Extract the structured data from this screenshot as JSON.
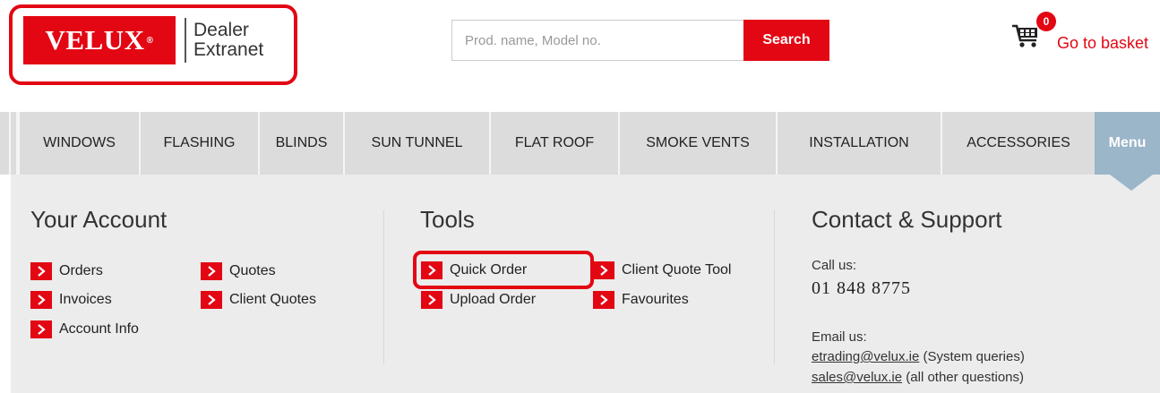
{
  "header": {
    "logo": {
      "brand": "VELUX",
      "registered": "®",
      "line1": "Dealer",
      "line2": "Extranet"
    },
    "search": {
      "placeholder": "Prod. name, Model no.",
      "value": "",
      "button_label": "Search"
    },
    "basket": {
      "count": "0",
      "label": "Go to basket",
      "icon": "shopping-cart-icon"
    }
  },
  "nav": {
    "items": [
      {
        "label": "WINDOWS"
      },
      {
        "label": "FLASHING"
      },
      {
        "label": "BLINDS"
      },
      {
        "label": "SUN TUNNEL"
      },
      {
        "label": "FLAT ROOF"
      },
      {
        "label": "SMOKE VENTS"
      },
      {
        "label": "INSTALLATION"
      },
      {
        "label": "ACCESSORIES"
      }
    ],
    "menu_label": "Menu"
  },
  "your_account": {
    "title": "Your Account",
    "links": [
      {
        "label": "Orders"
      },
      {
        "label": "Invoices"
      },
      {
        "label": "Account Info"
      },
      {
        "label": "Quotes"
      },
      {
        "label": "Client Quotes"
      }
    ]
  },
  "tools": {
    "title": "Tools",
    "links": [
      {
        "label": "Quick Order"
      },
      {
        "label": "Upload Order"
      },
      {
        "label": "Client Quote Tool"
      },
      {
        "label": "Favourites"
      }
    ]
  },
  "contact": {
    "title": "Contact & Support",
    "call_label": "Call us:",
    "phone": "01 848 8775",
    "email_label": "Email us:",
    "emails": [
      {
        "address": "etrading@velux.ie",
        "note": "(System queries)"
      },
      {
        "address": "sales@velux.ie",
        "note": "(all other questions)"
      }
    ]
  },
  "colors": {
    "accent": "#e30613",
    "nav_bg": "#dcdcdc",
    "panel_bg": "#ececec",
    "menu_bg": "#9bb5c9"
  }
}
